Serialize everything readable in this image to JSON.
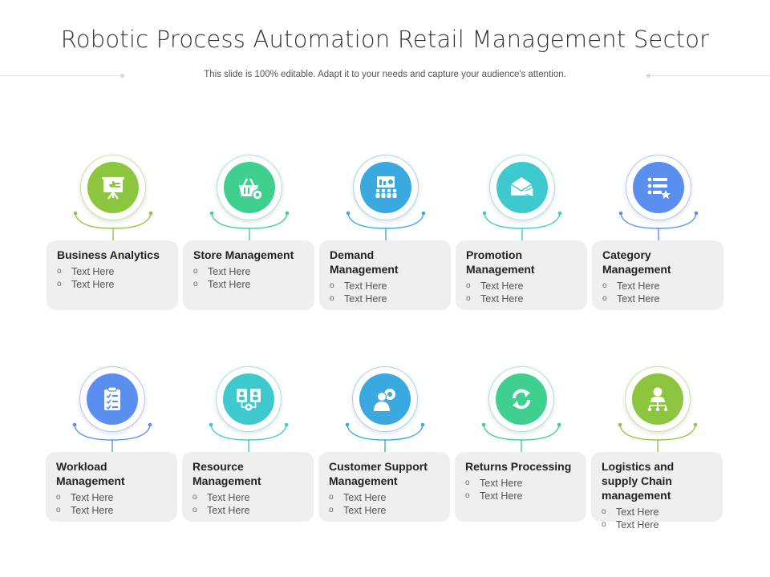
{
  "title": "Robotic Process Automation Retail Management Sector",
  "subtitle": "This slide is 100% editable. Adapt it to your needs and capture your audience's attention.",
  "bullet_glyph": "o",
  "items": [
    {
      "title": "Business Analytics",
      "bullets": [
        "Text Here",
        "Text Here"
      ],
      "icon": "presentation-board-icon",
      "color": "#8cc63f",
      "ring": "#c8e3a0"
    },
    {
      "title": "Store Management",
      "bullets": [
        "Text Here",
        "Text Here"
      ],
      "icon": "basket-gear-icon",
      "color": "#3fcf8e",
      "ring": "#a8e6cc"
    },
    {
      "title": "Demand Management",
      "bullets": [
        "Text Here",
        "Text Here"
      ],
      "icon": "audience-presentation-icon",
      "color": "#3aa9e0",
      "ring": "#a6d4ee"
    },
    {
      "title": "Promotion Management",
      "bullets": [
        "Text Here",
        "Text Here"
      ],
      "icon": "email-megaphone-icon",
      "color": "#3ec9cf",
      "ring": "#a5e2e4"
    },
    {
      "title": "Category Management",
      "bullets": [
        "Text Here",
        "Text Here"
      ],
      "icon": "list-star-icon",
      "color": "#5a8ff0",
      "ring": "#b3c8f0"
    },
    {
      "title": "Workload Management",
      "bullets": [
        "Text Here",
        "Text Here"
      ],
      "icon": "clipboard-checklist-icon",
      "color": "#5a8ff0",
      "ring": "#b3c8f0"
    },
    {
      "title": "Resource Management",
      "bullets": [
        "Text Here",
        "Text Here"
      ],
      "icon": "profiles-gear-icon",
      "color": "#3ec9cf",
      "ring": "#a5e2e4"
    },
    {
      "title": "Customer Support Management",
      "bullets": [
        "Text Here",
        "Text Here"
      ],
      "icon": "user-gear-icon",
      "color": "#3aa9e0",
      "ring": "#a6d4ee"
    },
    {
      "title": "Returns Processing",
      "bullets": [
        "Text Here",
        "Text Here"
      ],
      "icon": "refresh-arrows-icon",
      "color": "#3fcf8e",
      "ring": "#a8e6cc"
    },
    {
      "title": "Logistics and supply Chain management",
      "bullets": [
        "Text Here",
        "Text Here"
      ],
      "icon": "person-network-icon",
      "color": "#8cc63f",
      "ring": "#c8e3a0"
    }
  ]
}
